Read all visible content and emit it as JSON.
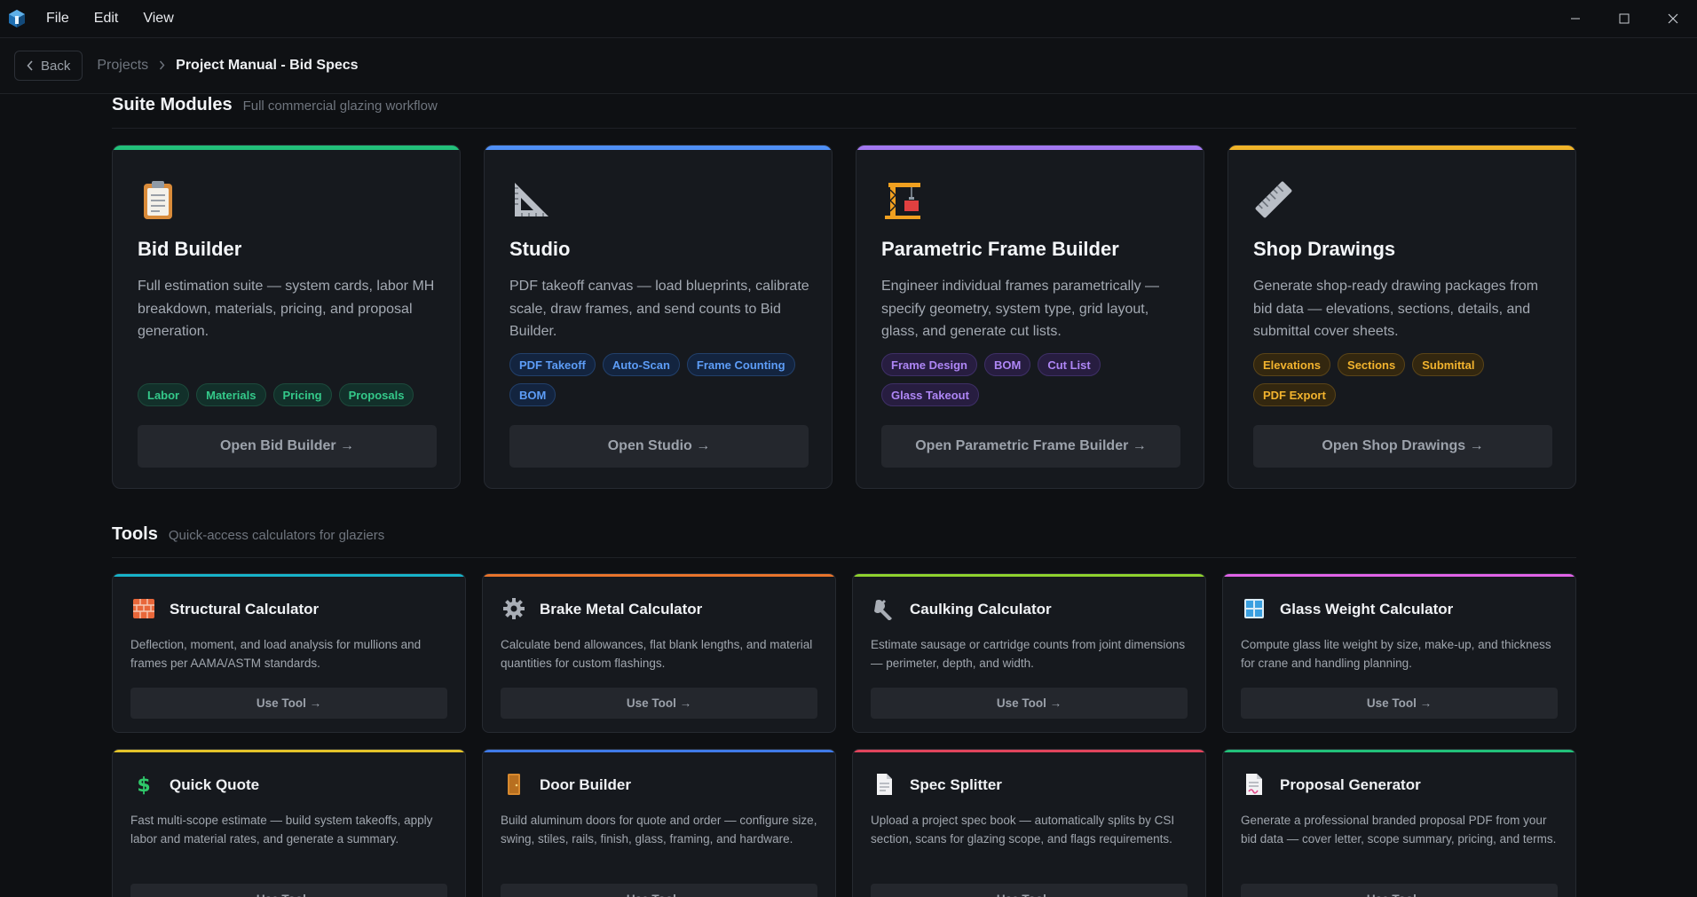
{
  "titlebar": {
    "menu": [
      "File",
      "Edit",
      "View"
    ]
  },
  "nav": {
    "back_label": "Back",
    "breadcrumb_parent": "Projects",
    "breadcrumb_current": "Project Manual - Bid Specs"
  },
  "suite": {
    "title": "Suite Modules",
    "subtitle": "Full commercial glazing workflow",
    "modules": [
      {
        "title": "Bid Builder",
        "icon": "clipboard-icon",
        "accent": "#22c07a",
        "desc": "Full estimation suite — system cards, labor MH breakdown, materials, pricing, and proposal generation.",
        "tags": [
          "Labor",
          "Materials",
          "Pricing",
          "Proposals"
        ],
        "button": "Open Bid Builder →"
      },
      {
        "title": "Studio",
        "icon": "triangle-ruler-icon",
        "accent": "#4f8ff5",
        "desc": "PDF takeoff canvas — load blueprints, calibrate scale, draw frames, and send counts to Bid Builder.",
        "tags": [
          "PDF Takeoff",
          "Auto-Scan",
          "Frame Counting",
          "BOM"
        ],
        "button": "Open Studio →"
      },
      {
        "title": "Parametric Frame Builder",
        "icon": "crane-icon",
        "accent": "#a278f0",
        "desc": "Engineer individual frames parametrically — specify geometry, system type, grid layout, glass, and generate cut lists.",
        "tags": [
          "Frame Design",
          "BOM",
          "Cut List",
          "Glass Takeout"
        ],
        "button": "Open Parametric Frame Builder →"
      },
      {
        "title": "Shop Drawings",
        "icon": "ruler-icon",
        "accent": "#f0b429",
        "desc": "Generate shop-ready drawing packages from bid data — elevations, sections, details, and submittal cover sheets.",
        "tags": [
          "Elevations",
          "Sections",
          "Submittal",
          "PDF Export"
        ],
        "button": "Open Shop Drawings →"
      }
    ]
  },
  "tools": {
    "title": "Tools",
    "subtitle": "Quick-access calculators for glaziers",
    "items": [
      {
        "title": "Structural Calculator",
        "icon": "brick-icon",
        "accent": "#17b3c9",
        "desc": "Deflection, moment, and load analysis for mullions and frames per AAMA/ASTM standards.",
        "button": "Use Tool →"
      },
      {
        "title": "Brake Metal Calculator",
        "icon": "gear-icon",
        "accent": "#e8742c",
        "desc": "Calculate bend allowances, flat blank lengths, and material quantities for custom flashings.",
        "button": "Use Tool →"
      },
      {
        "title": "Caulking Calculator",
        "icon": "wrench-icon",
        "accent": "#8fd22e",
        "desc": "Estimate sausage or cartridge counts from joint dimensions — perimeter, depth, and width.",
        "button": "Use Tool →"
      },
      {
        "title": "Glass Weight Calculator",
        "icon": "window-icon",
        "accent": "#e063e8",
        "desc": "Compute glass lite weight by size, make-up, and thickness for crane and handling planning.",
        "button": "Use Tool →"
      },
      {
        "title": "Quick Quote",
        "icon": "dollar-icon",
        "accent": "#e3c32a",
        "desc": "Fast multi-scope estimate — build system takeoffs, apply labor and material rates, and generate a summary.",
        "button": "Use Tool →"
      },
      {
        "title": "Door Builder",
        "icon": "door-icon",
        "accent": "#3f7ae8",
        "desc": "Build aluminum doors for quote and order — configure size, swing, stiles, rails, finish, glass, framing, and hardware.",
        "button": "Use Tool →"
      },
      {
        "title": "Spec Splitter",
        "icon": "document-icon",
        "accent": "#e0445c",
        "desc": "Upload a project spec book — automatically splits by CSI section, scans for glazing scope, and flags requirements.",
        "button": "Use Tool →"
      },
      {
        "title": "Proposal Generator",
        "icon": "signed-document-icon",
        "accent": "#22c07a",
        "desc": "Generate a professional branded proposal PDF from your bid data — cover letter, scope summary, pricing, and terms.",
        "button": "Use Tool →"
      }
    ]
  }
}
